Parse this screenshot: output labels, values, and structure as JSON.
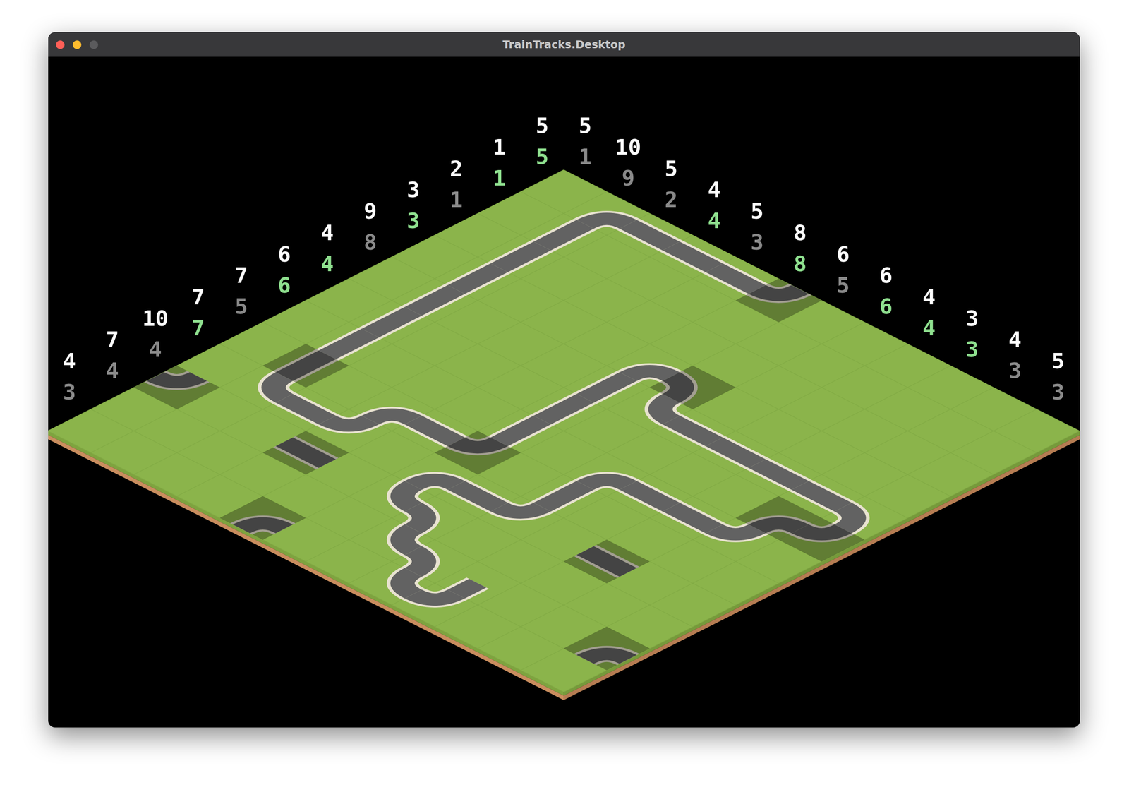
{
  "window": {
    "title": "TrainTracks.Desktop"
  },
  "board": {
    "size": 12,
    "row_clues": [
      {
        "target": "5",
        "count": "5",
        "satisfied": true
      },
      {
        "target": "1",
        "count": "1",
        "satisfied": true
      },
      {
        "target": "2",
        "count": "1",
        "satisfied": false
      },
      {
        "target": "3",
        "count": "3",
        "satisfied": true
      },
      {
        "target": "9",
        "count": "8",
        "satisfied": false
      },
      {
        "target": "4",
        "count": "4",
        "satisfied": true
      },
      {
        "target": "6",
        "count": "6",
        "satisfied": true
      },
      {
        "target": "7",
        "count": "5",
        "satisfied": false
      },
      {
        "target": "7",
        "count": "7",
        "satisfied": true
      },
      {
        "target": "10",
        "count": "4",
        "satisfied": false
      },
      {
        "target": "7",
        "count": "4",
        "satisfied": false
      },
      {
        "target": "4",
        "count": "3",
        "satisfied": false
      }
    ],
    "col_clues": [
      {
        "target": "5",
        "count": "1",
        "satisfied": false
      },
      {
        "target": "10",
        "count": "9",
        "satisfied": false
      },
      {
        "target": "5",
        "count": "2",
        "satisfied": false
      },
      {
        "target": "4",
        "count": "4",
        "satisfied": true
      },
      {
        "target": "5",
        "count": "3",
        "satisfied": false
      },
      {
        "target": "8",
        "count": "8",
        "satisfied": true
      },
      {
        "target": "6",
        "count": "5",
        "satisfied": false
      },
      {
        "target": "6",
        "count": "6",
        "satisfied": true
      },
      {
        "target": "4",
        "count": "4",
        "satisfied": true
      },
      {
        "target": "3",
        "count": "3",
        "satisfied": true
      },
      {
        "target": "4",
        "count": "3",
        "satisfied": false
      },
      {
        "target": "5",
        "count": "3",
        "satisfied": false
      }
    ],
    "tiles": [
      {
        "row": 0,
        "col": 1,
        "piece": "SE",
        "fixed": false
      },
      {
        "row": 0,
        "col": 2,
        "piece": "EW",
        "fixed": false
      },
      {
        "row": 0,
        "col": 3,
        "piece": "EW",
        "fixed": false
      },
      {
        "row": 0,
        "col": 4,
        "piece": "EW",
        "fixed": false
      },
      {
        "row": 0,
        "col": 5,
        "piece": "NW",
        "fixed": true
      },
      {
        "row": 1,
        "col": 1,
        "piece": "NS",
        "fixed": false
      },
      {
        "row": 2,
        "col": 1,
        "piece": "NS",
        "fixed": false
      },
      {
        "row": 3,
        "col": 1,
        "piece": "NS",
        "fixed": false
      },
      {
        "row": 4,
        "col": 1,
        "piece": "NS",
        "fixed": false
      },
      {
        "row": 5,
        "col": 1,
        "piece": "NS",
        "fixed": false
      },
      {
        "row": 6,
        "col": 1,
        "piece": "NS",
        "fixed": false
      },
      {
        "row": 7,
        "col": 1,
        "piece": "NS",
        "fixed": true
      },
      {
        "row": 8,
        "col": 1,
        "piece": "NE",
        "fixed": false
      },
      {
        "row": 8,
        "col": 2,
        "piece": "EW",
        "fixed": false
      },
      {
        "row": 8,
        "col": 3,
        "piece": "NW",
        "fixed": false
      },
      {
        "row": 7,
        "col": 3,
        "piece": "SE",
        "fixed": false
      },
      {
        "row": 7,
        "col": 4,
        "piece": "EW",
        "fixed": false
      },
      {
        "row": 7,
        "col": 5,
        "piece": "NW",
        "fixed": true
      },
      {
        "row": 6,
        "col": 5,
        "piece": "NS",
        "fixed": false
      },
      {
        "row": 5,
        "col": 5,
        "piece": "NS",
        "fixed": false
      },
      {
        "row": 4,
        "col": 5,
        "piece": "NS",
        "fixed": false
      },
      {
        "row": 3,
        "col": 5,
        "piece": "SE",
        "fixed": false
      },
      {
        "row": 3,
        "col": 6,
        "piece": "SW",
        "fixed": true
      },
      {
        "row": 4,
        "col": 6,
        "piece": "NE",
        "fixed": false
      },
      {
        "row": 4,
        "col": 7,
        "piece": "EW",
        "fixed": false
      },
      {
        "row": 4,
        "col": 8,
        "piece": "EW",
        "fixed": false
      },
      {
        "row": 4,
        "col": 9,
        "piece": "EW",
        "fixed": false
      },
      {
        "row": 4,
        "col": 10,
        "piece": "EW",
        "fixed": false
      },
      {
        "row": 4,
        "col": 11,
        "piece": "SW",
        "fixed": false
      },
      {
        "row": 5,
        "col": 11,
        "piece": "NW",
        "fixed": true
      },
      {
        "row": 5,
        "col": 10,
        "piece": "SE",
        "fixed": true
      },
      {
        "row": 6,
        "col": 10,
        "piece": "NW",
        "fixed": false
      },
      {
        "row": 6,
        "col": 9,
        "piece": "EW",
        "fixed": false
      },
      {
        "row": 6,
        "col": 8,
        "piece": "EW",
        "fixed": false
      },
      {
        "row": 6,
        "col": 7,
        "piece": "SE",
        "fixed": false
      },
      {
        "row": 7,
        "col": 7,
        "piece": "NS",
        "fixed": false
      },
      {
        "row": 8,
        "col": 7,
        "piece": "NW",
        "fixed": false
      },
      {
        "row": 8,
        "col": 6,
        "piece": "EW",
        "fixed": false
      },
      {
        "row": 8,
        "col": 5,
        "piece": "SE",
        "fixed": false
      },
      {
        "row": 9,
        "col": 5,
        "piece": "NE",
        "fixed": false
      },
      {
        "row": 9,
        "col": 6,
        "piece": "SW",
        "fixed": false
      },
      {
        "row": 10,
        "col": 6,
        "piece": "NE",
        "fixed": false
      },
      {
        "row": 10,
        "col": 7,
        "piece": "SW",
        "fixed": false
      },
      {
        "row": 11,
        "col": 7,
        "piece": "NE",
        "fixed": false
      },
      {
        "row": 11,
        "col": 8,
        "piece": "NW",
        "fixed": false
      },
      {
        "row": 10,
        "col": 8,
        "piece": "S",
        "fixed": false
      },
      {
        "row": 9,
        "col": 0,
        "piece": "NW",
        "fixed": true
      },
      {
        "row": 9,
        "col": 3,
        "piece": "EW",
        "fixed": true
      },
      {
        "row": 8,
        "col": 9,
        "piece": "EW",
        "fixed": true
      },
      {
        "row": 11,
        "col": 4,
        "piece": "SE",
        "fixed": true
      },
      {
        "row": 10,
        "col": 11,
        "piece": "SE",
        "fixed": true
      }
    ]
  }
}
